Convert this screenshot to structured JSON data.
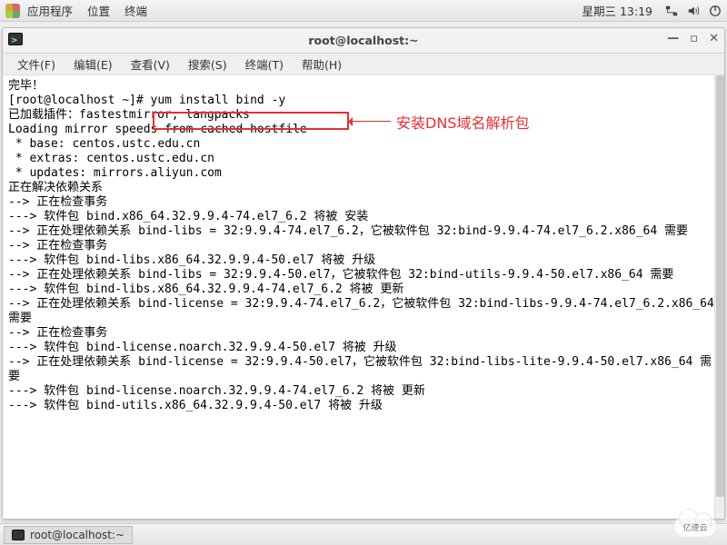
{
  "top_panel": {
    "items": [
      "应用程序",
      "位置",
      "终端"
    ],
    "clock": "星期三 13:19"
  },
  "window": {
    "title": "root@localhost:~",
    "min": "—",
    "max": "▫",
    "close": "✕"
  },
  "menubar": {
    "items": [
      "文件(F)",
      "编辑(E)",
      "查看(V)",
      "搜索(S)",
      "终端(T)",
      "帮助(H)"
    ]
  },
  "annotation": {
    "text": "安装DNS域名解析包"
  },
  "terminal": {
    "lines": [
      "完毕！",
      "[root@localhost ~]# yum install bind -y",
      "已加载插件：fastestmirror, langpacks",
      "Loading mirror speeds from cached hostfile",
      " * base: centos.ustc.edu.cn",
      " * extras: centos.ustc.edu.cn",
      " * updates: mirrors.aliyun.com",
      "正在解决依赖关系",
      "--> 正在检查事务",
      "---> 软件包 bind.x86_64.32.9.9.4-74.el7_6.2 将被 安装",
      "--> 正在处理依赖关系 bind-libs = 32:9.9.4-74.el7_6.2，它被软件包 32:bind-9.9.4-74.el7_6.2.x86_64 需要",
      "--> 正在检查事务",
      "---> 软件包 bind-libs.x86_64.32.9.9.4-50.el7 将被 升级",
      "--> 正在处理依赖关系 bind-libs = 32:9.9.4-50.el7，它被软件包 32:bind-utils-9.9.4-50.el7.x86_64 需要",
      "---> 软件包 bind-libs.x86_64.32.9.9.4-74.el7_6.2 将被 更新",
      "--> 正在处理依赖关系 bind-license = 32:9.9.4-74.el7_6.2，它被软件包 32:bind-libs-9.9.4-74.el7_6.2.x86_64 需要",
      "--> 正在检查事务",
      "---> 软件包 bind-license.noarch.32.9.9.4-50.el7 将被 升级",
      "--> 正在处理依赖关系 bind-license = 32:9.9.4-50.el7，它被软件包 32:bind-libs-lite-9.9.4-50.el7.x86_64 需要",
      "---> 软件包 bind-license.noarch.32.9.9.4-74.el7_6.2 将被 更新",
      "---> 软件包 bind-utils.x86_64.32.9.9.4-50.el7 将被 升级"
    ]
  },
  "taskbar": {
    "task_label": "root@localhost:~"
  },
  "watermarks": {
    "cloud": "亿速云"
  }
}
